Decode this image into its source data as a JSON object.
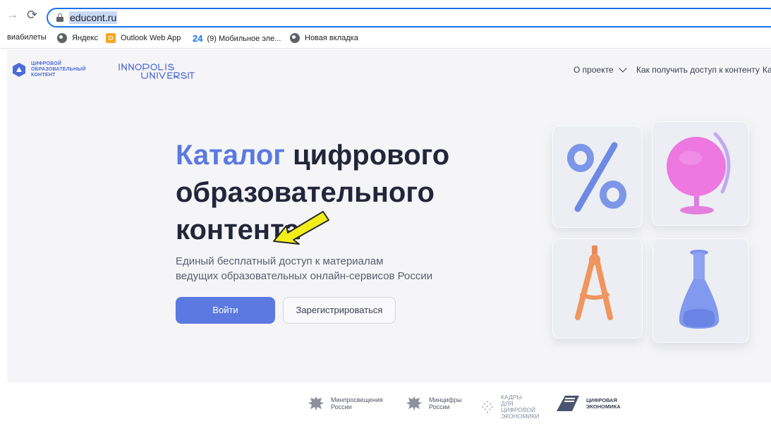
{
  "browser": {
    "url": "educont.ru",
    "bookmarks": [
      {
        "label": "виабилеты",
        "icon": "none"
      },
      {
        "label": "Яндекс",
        "icon": "globe-icon"
      },
      {
        "label": "Outlook Web App",
        "icon": "outlook-icon"
      },
      {
        "label": "(9) Мобильное эле...",
        "icon": "24-icon",
        "prefix": "24"
      },
      {
        "label": "Новая вкладка",
        "icon": "globe-icon"
      }
    ],
    "outlook_glyph": "O"
  },
  "header": {
    "logo_lines": [
      "ЦИФРОВОЙ",
      "ОБРАЗОВАТЕЛЬНЫЙ",
      "КОНТЕНТ"
    ],
    "nav": {
      "about": "О проекте",
      "access": "Как получить доступ к контенту",
      "more": "Ка"
    }
  },
  "hero": {
    "title_accent": "Каталог",
    "title_rest_1": "цифрового",
    "title_line_2": "образовательного",
    "title_line_3": "контента",
    "subtitle_line_1": "Единый бесплатный доступ к материалам",
    "subtitle_line_2": "ведущих образовательных онлайн-сервисов России",
    "login_label": "Войти",
    "register_label": "Зарегистрироваться"
  },
  "partners": {
    "p1": [
      "Минпросвещения",
      "России"
    ],
    "p2": [
      "Минцифры",
      "России"
    ],
    "p3": [
      "КАДРЫ",
      "ДЛЯ ЦИФРОВОЙ",
      "ЭКОНОМИКИ"
    ],
    "p4": [
      "ЦИФРОВАЯ",
      "ЭКОНОМИКА"
    ]
  },
  "colors": {
    "accent": "#5b79e0",
    "arrow_fill": "#f3ee1a",
    "arrow_stroke": "#2a2a2a"
  }
}
